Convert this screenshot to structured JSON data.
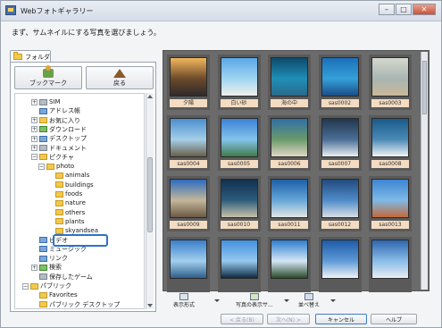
{
  "window": {
    "title": "Webフォトギャラリー",
    "instruction": "まず、サムネイルにする写真を選びましょう。",
    "controls": [
      "–",
      "□",
      "✕"
    ]
  },
  "left_pane": {
    "tab_label": "フォルダ",
    "bookmark_label": "ブックマーク",
    "back_label": "戻る",
    "tree": [
      {
        "label": "SIM",
        "expander": "+",
        "icon": "folder-icon",
        "color": "gray"
      },
      {
        "label": "アドレス帳",
        "expander": "",
        "icon": "address-book-icon",
        "color": "blue"
      },
      {
        "label": "お気に入り",
        "expander": "+",
        "icon": "favorites-icon",
        "color": "yellow"
      },
      {
        "label": "ダウンロード",
        "expander": "+",
        "icon": "downloads-icon",
        "color": "green"
      },
      {
        "label": "デスクトップ",
        "expander": "+",
        "icon": "desktop-icon",
        "color": "blue"
      },
      {
        "label": "ドキュメント",
        "expander": "+",
        "icon": "documents-icon",
        "color": "gray"
      },
      {
        "label": "ピクチャ",
        "expander": "−",
        "icon": "pictures-icon",
        "color": "yellow"
      },
      {
        "label": "photo",
        "expander": "−",
        "icon": "folder-icon",
        "color": "yellow"
      },
      {
        "label": "animals",
        "expander": "",
        "icon": "folder-icon",
        "color": "yellow"
      },
      {
        "label": "buildings",
        "expander": "",
        "icon": "folder-icon",
        "color": "yellow"
      },
      {
        "label": "foods",
        "expander": "",
        "icon": "folder-icon",
        "color": "yellow"
      },
      {
        "label": "nature",
        "expander": "",
        "icon": "folder-icon",
        "color": "yellow"
      },
      {
        "label": "others",
        "expander": "",
        "icon": "folder-icon",
        "color": "yellow"
      },
      {
        "label": "plants",
        "expander": "",
        "icon": "folder-icon",
        "color": "yellow"
      },
      {
        "label": "skyandsea",
        "expander": "",
        "icon": "folder-icon",
        "color": "yellow"
      },
      {
        "label": "ビデオ",
        "expander": "",
        "icon": "videos-icon",
        "color": "blue"
      },
      {
        "label": "ミュージック",
        "expander": "",
        "icon": "music-icon",
        "color": "blue"
      },
      {
        "label": "リンク",
        "expander": "",
        "icon": "links-icon",
        "color": "blue"
      },
      {
        "label": "検索",
        "expander": "+",
        "icon": "search-icon",
        "color": "green"
      },
      {
        "label": "保存したゲーム",
        "expander": "",
        "icon": "games-icon",
        "color": "gray"
      },
      {
        "label": "パブリック",
        "expander": "−",
        "icon": "folder-icon",
        "color": "yellow"
      },
      {
        "label": "Favorites",
        "expander": "",
        "icon": "folder-icon",
        "color": "yellow"
      },
      {
        "label": "パブリック デスクトップ",
        "expander": "",
        "icon": "folder-icon",
        "color": "yellow"
      }
    ],
    "selected": "skyandsea"
  },
  "gallery": {
    "thumbnails": [
      {
        "label": "夕陽",
        "colors": [
          "#f2b65c",
          "#6b4a2b",
          "#2e2a2a"
        ]
      },
      {
        "label": "白い砂",
        "colors": [
          "#5aa8e8",
          "#9fd4f2",
          "#f0f0ea"
        ]
      },
      {
        "label": "海の中",
        "colors": [
          "#0e4a6b",
          "#1f8fb8",
          "#2a6a8a"
        ]
      },
      {
        "label": "sas0002",
        "colors": [
          "#1b70b8",
          "#35a0d9",
          "#1a4e8a"
        ]
      },
      {
        "label": "sas0003",
        "colors": [
          "#d6d8cf",
          "#a8b5b2",
          "#c9b899"
        ]
      },
      {
        "label": "sas0004",
        "colors": [
          "#4b8fd0",
          "#a4cfe8",
          "#6a5e4a"
        ]
      },
      {
        "label": "sas0005",
        "colors": [
          "#3b82d4",
          "#84c3ec",
          "#3f7a4a"
        ]
      },
      {
        "label": "sas0006",
        "colors": [
          "#2f6fa6",
          "#6a9a6a",
          "#e0d6c4"
        ]
      },
      {
        "label": "sas0007",
        "colors": [
          "#22364f",
          "#4a6f96",
          "#e8eef2"
        ]
      },
      {
        "label": "sas0008",
        "colors": [
          "#1a5a8a",
          "#4a8ab6",
          "#f2f4f5"
        ]
      },
      {
        "label": "sas0009",
        "colors": [
          "#2c6cbf",
          "#c4b79a",
          "#6b5a45"
        ]
      },
      {
        "label": "sas0010",
        "colors": [
          "#11304f",
          "#2d5d7c",
          "#c7c0a8"
        ]
      },
      {
        "label": "sas0011",
        "colors": [
          "#1e5fa8",
          "#66a6d8",
          "#e2e6e4"
        ]
      },
      {
        "label": "sas0012",
        "colors": [
          "#214b7e",
          "#4f8cc9",
          "#d8dee4"
        ]
      },
      {
        "label": "sas0013",
        "colors": [
          "#3d86d3",
          "#7fb9e6",
          "#c46a3d"
        ]
      },
      {
        "label": "",
        "colors": [
          "#3b7fca",
          "#a2cfee",
          "#2f5e8c"
        ]
      },
      {
        "label": "",
        "colors": [
          "#4290df",
          "#96c9ee",
          "#0e2a40"
        ]
      },
      {
        "label": "",
        "colors": [
          "#2e7ed0",
          "#d4e6f5",
          "#2a4a2a"
        ]
      },
      {
        "label": "",
        "colors": [
          "#1d5ba8",
          "#5f9ad8",
          "#f0f3f6"
        ]
      },
      {
        "label": "",
        "colors": [
          "#2e66b0",
          "#8abde8",
          "#e8edf2"
        ]
      }
    ]
  },
  "toolbar": {
    "view_mode": "表示形式",
    "photo_display": "写真の表示サ...",
    "sort": "並べ替え"
  },
  "buttons": {
    "back": "< 戻る(B)",
    "next": "次へ(N) >",
    "cancel": "キャンセル",
    "help": "ヘルプ"
  }
}
